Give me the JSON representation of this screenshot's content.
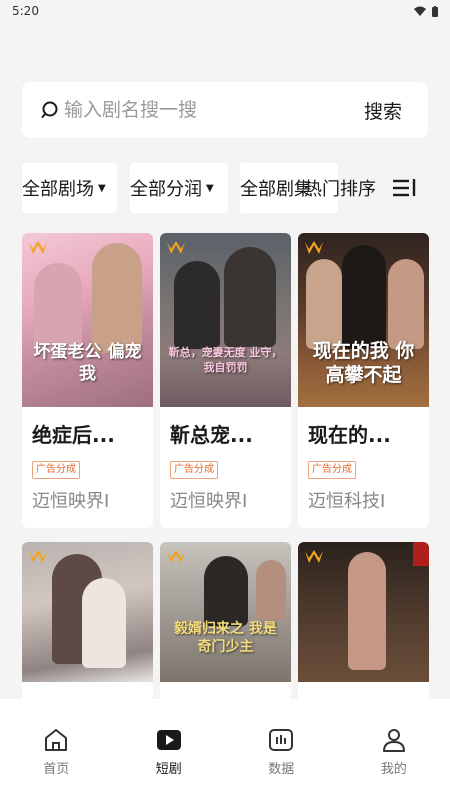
{
  "status": {
    "time": "5:20"
  },
  "search": {
    "placeholder": "输入剧名搜一搜",
    "button_label": "搜索"
  },
  "filters": {
    "theater": "全部剧场",
    "profit": "全部分润",
    "genre": "全部剧集",
    "sort": "热门排序"
  },
  "cards": [
    {
      "title": "绝症后...",
      "badge": "广告分成",
      "company": "迈恒映界I",
      "overlay": "坏蛋老公 偏宠我"
    },
    {
      "title": "靳总宠...",
      "badge": "广告分成",
      "company": "迈恒映界I",
      "overlay": "靳总，宠妻无度 业守，我自罚罚"
    },
    {
      "title": "现在的...",
      "badge": "广告分成",
      "company": "迈恒科技I",
      "overlay": "现在的我 你高攀不起"
    }
  ],
  "cards_row2": [
    {
      "overlay": ""
    },
    {
      "overlay": "毅婿归来之 我是奇门少主"
    },
    {
      "overlay": ""
    }
  ],
  "nav": [
    {
      "label": "首页",
      "icon": "home-icon"
    },
    {
      "label": "短剧",
      "icon": "play-icon"
    },
    {
      "label": "数据",
      "icon": "chart-icon"
    },
    {
      "label": "我的",
      "icon": "user-icon"
    }
  ]
}
